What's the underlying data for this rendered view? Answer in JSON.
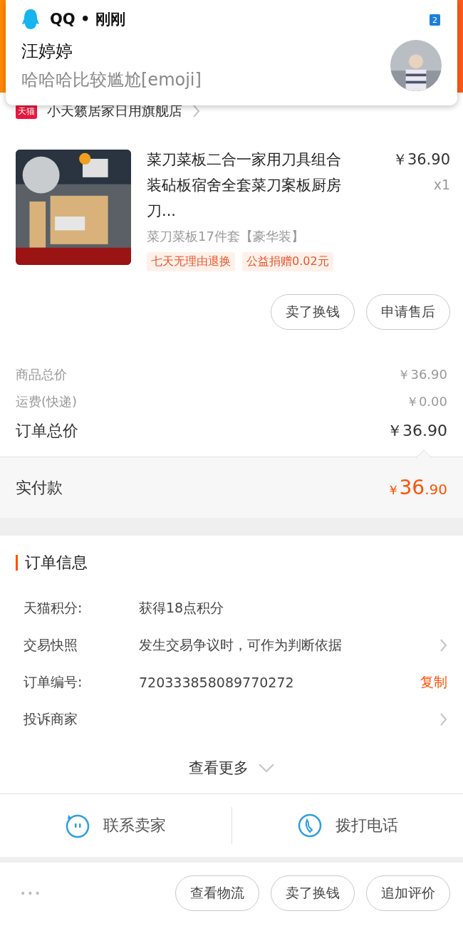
{
  "notification": {
    "app": "QQ • 刚刚",
    "badge": "2",
    "sender": "汪婷婷",
    "message": "哈哈哈比较尴尬[emoji]",
    "avatar": {
      "kind": "picture"
    }
  },
  "store": {
    "badge": "天猫",
    "name": "小天籁居家日用旗舰店"
  },
  "product": {
    "image": {
      "kind": "picture"
    },
    "title": "菜刀菜板二合一家用刀具组合装砧板宿舍全套菜刀案板厨房刀...",
    "price": "￥36.90",
    "quantity": "x1",
    "variant": "菜刀菜板17件套【豪华装】",
    "tags": [
      "七天无理由退换",
      "公益捐赠0.02元"
    ],
    "actions": [
      "卖了换钱",
      "申请售后"
    ]
  },
  "costs": [
    {
      "label": "商品总价",
      "value": "￥36.90",
      "kind": "minor"
    },
    {
      "label": "运费(快递)",
      "value": "￥0.00",
      "kind": "minor"
    },
    {
      "label": "订单总价",
      "value": "￥36.90",
      "kind": "major"
    }
  ],
  "paid": {
    "label": "实付款",
    "symbol": "￥",
    "main": "36",
    "fraction": ".90"
  },
  "order_info": {
    "title": "订单信息",
    "rows": [
      {
        "label": "天猫积分:",
        "value": "获得18点积分",
        "kind": "plain"
      },
      {
        "label": "交易快照",
        "value": "发生交易争议时，可作为判断依据",
        "kind": "link"
      },
      {
        "label": "订单编号:",
        "value": "720333858089770272",
        "kind": "copy",
        "action": "复制"
      },
      {
        "label": "投诉商家",
        "kind": "link"
      }
    ],
    "more": "查看更多"
  },
  "contact": [
    {
      "label": "联系卖家",
      "kind": "chat"
    },
    {
      "label": "拨打电话",
      "kind": "phone"
    }
  ],
  "bottom_bar": {
    "more": "•••",
    "buttons": [
      "查看物流",
      "卖了换钱",
      "追加评价"
    ]
  }
}
